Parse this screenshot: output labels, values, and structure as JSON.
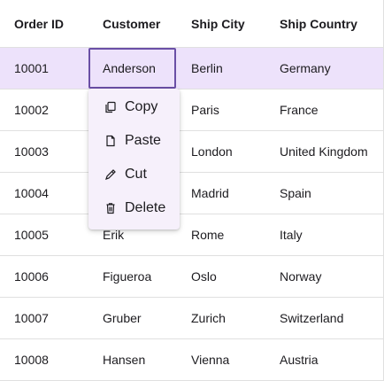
{
  "columns": [
    "Order ID",
    "Customer",
    "Ship City",
    "Ship Country"
  ],
  "rows": [
    [
      "10001",
      "Anderson",
      "Berlin",
      "Germany"
    ],
    [
      "10002",
      "",
      "Paris",
      "France"
    ],
    [
      "10003",
      "",
      "London",
      "United Kingdom"
    ],
    [
      "10004",
      "",
      "Madrid",
      "Spain"
    ],
    [
      "10005",
      "Erik",
      "Rome",
      "Italy"
    ],
    [
      "10006",
      "Figueroa",
      "Oslo",
      "Norway"
    ],
    [
      "10007",
      "Gruber",
      "Zurich",
      "Switzerland"
    ],
    [
      "10008",
      "Hansen",
      "Vienna",
      "Austria"
    ]
  ],
  "selected_row": 0,
  "context_menu": {
    "items": [
      {
        "label": "Copy",
        "icon": "copy-icon"
      },
      {
        "label": "Paste",
        "icon": "paste-icon"
      },
      {
        "label": "Cut",
        "icon": "cut-icon"
      },
      {
        "label": "Delete",
        "icon": "delete-icon"
      }
    ]
  },
  "colors": {
    "selected_row_bg": "#ede2fb",
    "focus_border": "#6a4fa6",
    "menu_bg": "#f6f0fb",
    "grid_line": "#e0e0e0"
  }
}
